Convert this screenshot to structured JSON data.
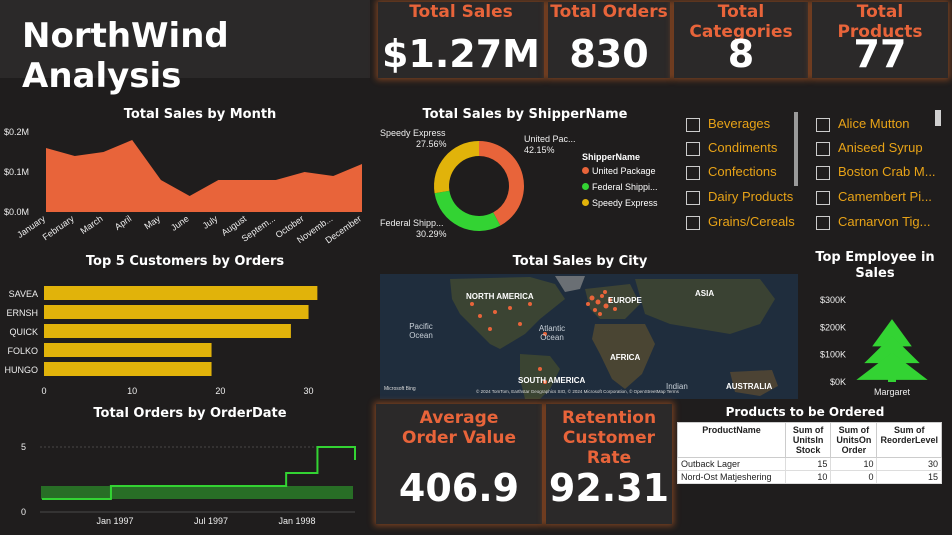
{
  "header": {
    "title": "NorthWind Analysis"
  },
  "kpis": {
    "total_sales": {
      "label": "Total Sales",
      "value": "$1.27M"
    },
    "total_orders": {
      "label": "Total Orders",
      "value": "830"
    },
    "total_categories": {
      "label": "Total Categories",
      "value": "8"
    },
    "total_products": {
      "label": "Total Products",
      "value": "77"
    },
    "avg_order_value": {
      "label": "Average Order Value",
      "value": "406.9"
    },
    "retention_rate": {
      "label": "Retention Customer Rate",
      "value": "92.31"
    }
  },
  "colors": {
    "accent": "#e8643a",
    "background": "#1f1d1d",
    "card": "#2b2929",
    "area": "#e8643a",
    "bar": "#e1b30a",
    "green": "#33d333",
    "slicer_text": "#e8a317"
  },
  "sales_by_month": {
    "title": "Total Sales by Month",
    "y_ticks": [
      "$0.2M",
      "$0.1M",
      "$0.0M"
    ],
    "months": [
      "January",
      "February",
      "March",
      "April",
      "May",
      "June",
      "July",
      "August",
      "Septem...",
      "October",
      "Novemb...",
      "December"
    ],
    "chart_data": {
      "type": "area",
      "categories": [
        "January",
        "February",
        "March",
        "April",
        "May",
        "June",
        "July",
        "August",
        "Septem...",
        "October",
        "Novemb...",
        "December"
      ],
      "values": [
        0.16,
        0.14,
        0.15,
        0.18,
        0.08,
        0.04,
        0.08,
        0.08,
        0.08,
        0.1,
        0.09,
        0.12
      ],
      "ylim": [
        0,
        0.2
      ]
    }
  },
  "sales_by_shipper": {
    "title": "Total Sales by ShipperName",
    "legend_title": "ShipperName",
    "legend": [
      "United Package",
      "Federal Shippi...",
      "Speedy Express"
    ],
    "labels": [
      {
        "name": "United Pac...",
        "pct": "42.15%"
      },
      {
        "name": "Federal Shipp...",
        "pct": "30.29%"
      },
      {
        "name": "Speedy Express",
        "pct": "27.56%"
      }
    ],
    "chart_data": {
      "type": "pie",
      "categories": [
        "United Package",
        "Federal Shipping",
        "Speedy Express"
      ],
      "values": [
        42.15,
        30.29,
        27.56
      ],
      "colors": [
        "#e8643a",
        "#33d333",
        "#e1b30a"
      ]
    }
  },
  "category_slicer": {
    "items": [
      "Beverages",
      "Condiments",
      "Confections",
      "Dairy Products",
      "Grains/Cereals"
    ]
  },
  "product_slicer": {
    "items": [
      "Alice Mutton",
      "Aniseed Syrup",
      "Boston Crab M...",
      "Camembert Pi...",
      "Carnarvon Tig..."
    ]
  },
  "top_customers": {
    "title": "Top 5 Customers by Orders",
    "x_ticks": [
      "0",
      "10",
      "20",
      "30"
    ],
    "chart_data": {
      "type": "bar",
      "categories": [
        "SAVEA",
        "ERNSH",
        "QUICK",
        "FOLKO",
        "HUNGO"
      ],
      "values": [
        31,
        30,
        28,
        19,
        19
      ],
      "xlim": [
        0,
        33
      ]
    }
  },
  "sales_by_city": {
    "title": "Total Sales by City",
    "labels": [
      "NORTH AMERICA",
      "EUROPE",
      "ASIA",
      "Pacific Ocean",
      "Atlantic Ocean",
      "AFRICA",
      "SOUTH AMERICA",
      "Indian",
      "AUSTRALIA"
    ],
    "attribution": "© 2024 TomTom, Earthstar Geographics SIO, © 2024 Microsoft Corporation, © OpenStreetMap Terms",
    "logo": "Microsoft Bing"
  },
  "top_employee": {
    "title": "Top Employee in Sales",
    "y_ticks": [
      "$300K",
      "$200K",
      "$100K",
      "$0K"
    ],
    "employee": "Margaret",
    "chart_data": {
      "type": "bar",
      "categories": [
        "Margaret"
      ],
      "values": [
        230
      ],
      "ylim": [
        0,
        300
      ]
    }
  },
  "orders_by_date": {
    "title": "Total Orders by OrderDate",
    "y_ticks": [
      "5",
      "0"
    ],
    "x_ticks": [
      "Jan 1997",
      "Jul 1997",
      "Jan 1998"
    ],
    "chart_data": {
      "type": "line",
      "x": [
        "Jul 1996",
        "Jan 1997",
        "Jul 1997",
        "Jan 1998",
        "Feb 1998",
        "Mar 1998",
        "May 1998"
      ],
      "values": [
        1,
        2,
        2,
        2,
        3,
        5,
        4
      ],
      "ylim": [
        0,
        6
      ]
    }
  },
  "products_to_order": {
    "title": "Products to be Ordered",
    "columns": [
      "ProductName",
      "Sum of UnitsIn Stock",
      "Sum of UnitsOn Order",
      "Sum of ReorderLevel"
    ],
    "rows": [
      [
        "Outback Lager",
        "15",
        "10",
        "30"
      ],
      [
        "Nord-Ost Matjeshering",
        "10",
        "0",
        "15"
      ]
    ]
  }
}
